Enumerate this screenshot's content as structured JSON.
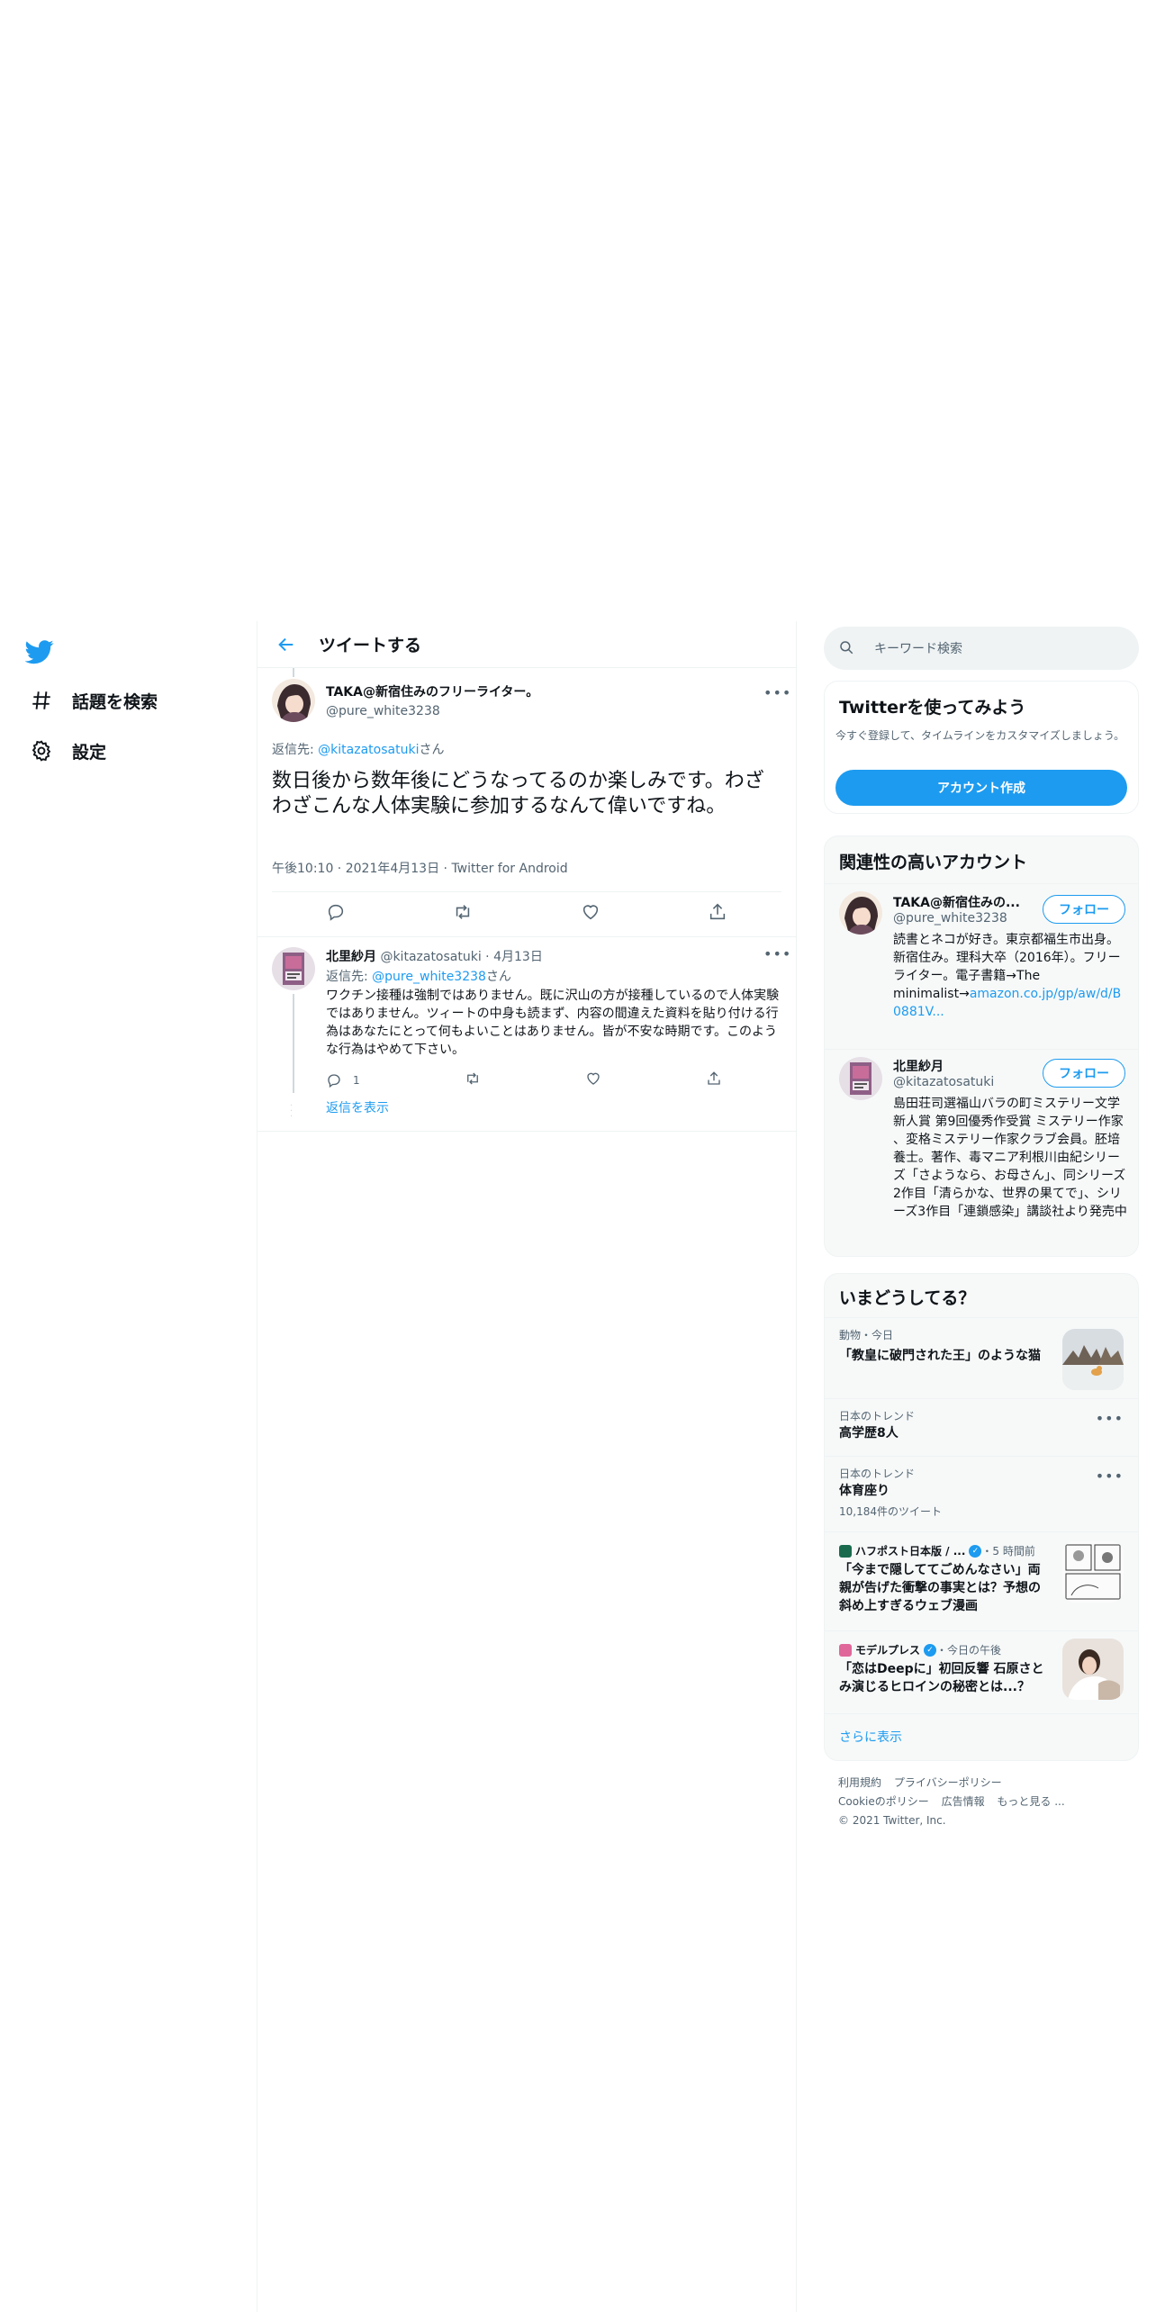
{
  "nav": {
    "explore_label": "話題を検索",
    "settings_label": "設定"
  },
  "main": {
    "header_title": "ツイートする",
    "focused_tweet": {
      "author_name": "TAKA@新宿住みのフリーライター。",
      "author_handle": "@pure_white3238",
      "reply_prefix": "返信先: ",
      "reply_to": "@kitazatosatuki",
      "reply_suffix": "さん",
      "text": "数日後から数年後にどうなってるのか楽しみです。わざわざこんな人体実験に参加するなんて偉いですね。",
      "time": "午後10:10",
      "date": "2021年4月13日",
      "source": "Twitter for Android"
    },
    "reply_tweet": {
      "author_name": "北里紗月",
      "author_handle": "@kitazatosatuki",
      "date": "4月13日",
      "reply_prefix": "返信先: ",
      "reply_to": "@pure_white3238",
      "reply_suffix": "さん",
      "text": "ワクチン接種は強制ではありません。既に沢山の方が接種しているので人体実験ではありません。ツィートの中身も読まず、内容の間違えた資料を貼り付ける行為はあなたにとって何もよいことはありません。皆が不安な時期です。このような行為はやめて下さい。",
      "reply_count": "1",
      "show_replies": "返信を表示"
    }
  },
  "sidebar": {
    "search_placeholder": "キーワード検索",
    "signup": {
      "title": "Twitterを使ってみよう",
      "desc": "今すぐ登録して、タイムラインをカスタマイズしましょう。",
      "button": "アカウント作成"
    },
    "related": {
      "title": "関連性の高いアカウント",
      "follow_label": "フォロー",
      "accounts": [
        {
          "name": "TAKA@新宿住みの...",
          "handle": "@pure_white3238",
          "bio": "読書とネコが好き。東京都福生市出身。新宿住み。理科大卒（2016年）。フリーライター。電子書籍→The minimalist→",
          "bio_link": "amazon.co.jp/gp/aw/d/B0881V..."
        },
        {
          "name": "北里紗月",
          "handle": "@kitazatosatuki",
          "bio": "島田荘司選福山バラの町ミステリー文学新人賞 第9回優秀作受賞 ミステリー作家 、変格ミステリー作家クラブ会員。胚培養士。著作、毒マニア利根川由紀シリーズ「さようなら、お母さん」、同シリーズ2作目「清らかな、世界の果てで」、シリーズ3作目「連鎖感染」講談社より発売中",
          "bio_link": ""
        }
      ]
    },
    "trends": {
      "title": "いまどうしてる？",
      "items": [
        {
          "meta": "動物・今日",
          "title": "「教皇に破門された王」のような猫",
          "count": ""
        },
        {
          "meta": "日本のトレンド",
          "title": "高学歴8人",
          "count": ""
        },
        {
          "meta": "日本のトレンド",
          "title": "体育座り",
          "count": "10,184件のツイート"
        },
        {
          "meta_source": "ハフポスト日本版 / ...",
          "meta_time": "・5 時間前",
          "title": "「今まで隠しててごめんなさい」両親が告げた衝撃の事実とは？予想の斜め上すぎるウェブ漫画"
        },
        {
          "meta_source": "モデルプレス",
          "meta_time": "・今日の午後",
          "title": "「恋はDeepに」初回反響 石原さとみ演じるヒロインの秘密とは...？"
        }
      ],
      "show_more": "さらに表示"
    },
    "footer": {
      "terms": "利用規約",
      "privacy": "プライバシーポリシー",
      "cookie": "Cookieのポリシー",
      "ads": "広告情報",
      "more": "もっと見る ...",
      "copyright": "© 2021 Twitter, Inc."
    }
  },
  "colors": {
    "accent": "#1d9bf0",
    "text": "#0f1419",
    "muted": "#536471",
    "border": "#eff3f4",
    "card_bg": "#f7f9f9"
  }
}
